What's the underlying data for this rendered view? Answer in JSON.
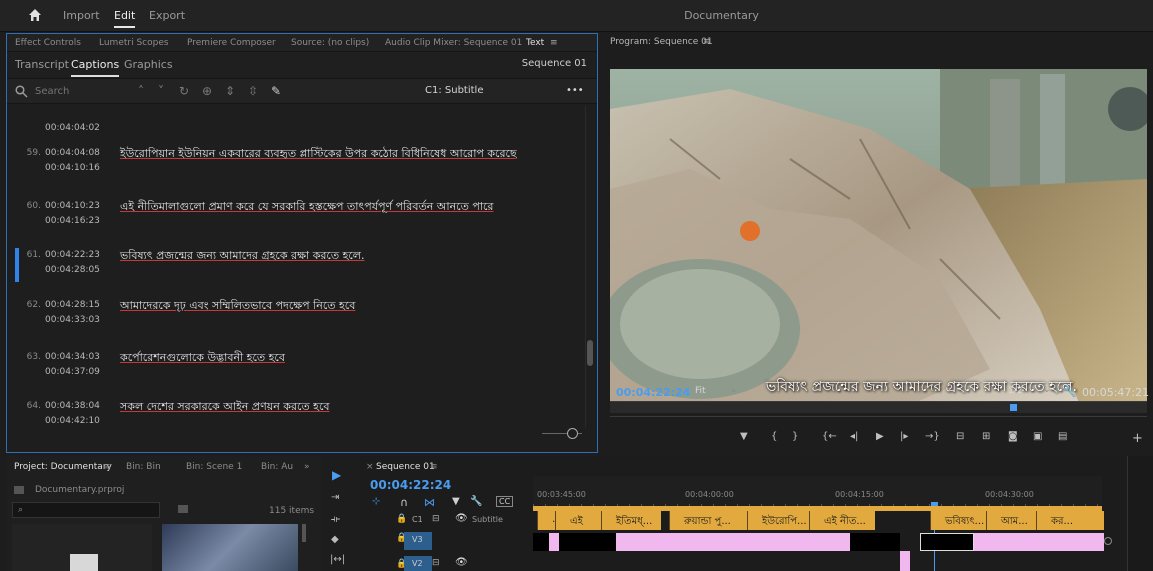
{
  "topbar": {
    "nav": [
      "Import",
      "Edit",
      "Export"
    ],
    "active": "Edit",
    "title": "Documentary"
  },
  "text_panel": {
    "tabs": [
      "Effect Controls",
      "Lumetri Scopes",
      "Premiere Composer",
      "Source: (no clips)",
      "Audio Clip Mixer: Sequence 01",
      "Text"
    ],
    "active_tab": "Text",
    "subtabs": [
      "Transcript",
      "Captions",
      "Graphics"
    ],
    "active_subtab": "Captions",
    "sequence": "Sequence 01",
    "search_placeholder": "Search",
    "track_label": "C1: Subtitle",
    "more": "•••",
    "partial_time": "00:04:04:02",
    "captions": [
      {
        "num": "59.",
        "in": "00:04:04:08",
        "out": "00:04:10:16",
        "text": "ইউরোপিয়ান ইউনিয়ন একবারের ব্যবহৃত প্লাস্টিকের উপর কঠোর বিধিনিষেধ আরোপ করেছে"
      },
      {
        "num": "60.",
        "in": "00:04:10:23",
        "out": "00:04:16:23",
        "text": "এই নীতিমালাগুলো প্রমাণ করে যে সরকারি হস্তক্ষেপ তাৎপর্যপূর্ণ পরিবর্তন আনতে পারে"
      },
      {
        "num": "61.",
        "in": "00:04:22:23",
        "out": "00:04:28:05",
        "text": "ভবিষ্যৎ প্রজন্মের জন্য আমাদের গ্রহকে রক্ষা করতে হলে."
      },
      {
        "num": "62.",
        "in": "00:04:28:15",
        "out": "00:04:33:03",
        "text": "আমাদেরকে দৃঢ় এবং সম্মিলিতভাবে পদক্ষেপ নিতে হবে"
      },
      {
        "num": "63.",
        "in": "00:04:34:03",
        "out": "00:04:37:09",
        "text": "কর্পোরেশনগুলোকে উদ্ভাবনী হতে হবে"
      },
      {
        "num": "64.",
        "in": "00:04:38:04",
        "out": "00:04:42:10",
        "text": "সকল দেশের সরকারকে আইন প্রণয়ন করতে হবে"
      }
    ]
  },
  "program": {
    "title": "Program: Sequence 01",
    "subtitle": "ভবিষ্যৎ প্রজন্মের জন্য আমাদের গ্রহকে রক্ষা করতে হলে.",
    "timecode": "00:04:22:24",
    "fit": "Fit",
    "resolution": "1/2",
    "duration": "00:05:47:21"
  },
  "project": {
    "tabs": [
      "Project: Documentary",
      "Bin: Bin",
      "Bin: Scene 1",
      "Bin: Au"
    ],
    "file": "Documentary.prproj",
    "items": "115 items"
  },
  "timeline": {
    "sequence_tab": "Sequence 01",
    "timecode": "00:04:22:24",
    "ruler": [
      "00:03:45:00",
      "00:04:00:00",
      "00:04:15:00",
      "00:04:30:00"
    ],
    "track_c1": "C1",
    "track_c1_name": "Subtitle",
    "track_v3": "V3",
    "track_v2": "V2",
    "clips": [
      "এই",
      "ইতিমধ্...",
      "রুয়ান্ডা পু...",
      "ইউরোপি...",
      "এই নীত...",
      "ভবিষ্যৎ...",
      "আম...",
      "কর..."
    ]
  },
  "colors": {
    "accent_blue": "#2e84e8",
    "clip_orange": "#e1a93e",
    "clip_pink": "#f1b7ef"
  }
}
